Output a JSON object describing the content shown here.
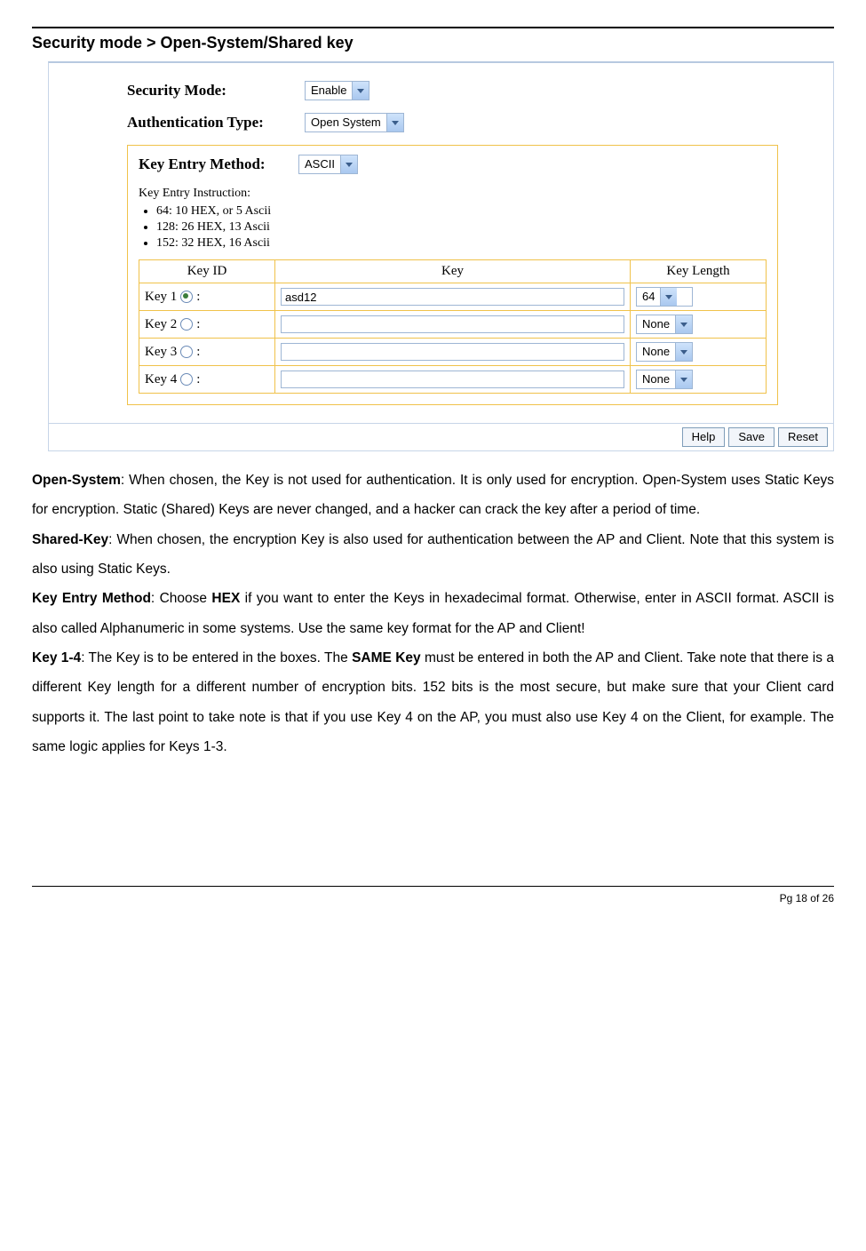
{
  "heading": "Security mode > Open-System/Shared key",
  "form": {
    "security_mode_label": "Security Mode:",
    "security_mode_value": "Enable",
    "auth_type_label": "Authentication Type:",
    "auth_type_value": "Open System",
    "key_entry_label": "Key Entry Method:",
    "key_entry_value": "ASCII",
    "instr_title": "Key Entry Instruction:",
    "instr": [
      "64: 10 HEX, or 5 Ascii",
      "128: 26 HEX, 13 Ascii",
      "152: 32 HEX, 16 Ascii"
    ],
    "table": {
      "headers": {
        "id": "Key ID",
        "key": "Key",
        "len": "Key Length"
      },
      "rows": [
        {
          "id": "Key 1",
          "checked": true,
          "value": "asd12",
          "len": "64"
        },
        {
          "id": "Key 2",
          "checked": false,
          "value": "",
          "len": "None"
        },
        {
          "id": "Key 3",
          "checked": false,
          "value": "",
          "len": "None"
        },
        {
          "id": "Key 4",
          "checked": false,
          "value": "",
          "len": "None"
        }
      ]
    },
    "buttons": {
      "help": "Help",
      "save": "Save",
      "reset": "Reset"
    }
  },
  "paragraphs": {
    "p1a": "Open-System",
    "p1b": ": When chosen, the Key is not used for authentication. It is only used for encryption. Open-System uses Static Keys for encryption. Static (Shared) Keys are never changed, and a hacker can crack the key after a period of time.",
    "p2a": "Shared-Key",
    "p2b": ": When chosen, the encryption Key is also used for authentication between the AP and Client. Note that this system is also using Static Keys.",
    "p3a": "Key Entry Method",
    "p3b": ": Choose ",
    "p3c": "HEX",
    "p3d": " if you want to enter the Keys in hexadecimal format. Otherwise, enter in ASCII format. ASCII is also called Alphanumeric in some systems. Use the same key format for the AP and Client!",
    "p4a": "Key 1-4",
    "p4b": ": The Key is to be entered in the boxes. The ",
    "p4c": "SAME Key",
    "p4d": " must be entered in both the AP and Client. Take note that there is a different Key length for a different number of encryption bits. 152 bits is the most secure, but make sure that your Client card supports it. The last point to take note is that if you use Key 4 on the AP, you must also use Key 4 on the Client, for example. The same logic applies for Keys 1-3."
  },
  "footer": "Pg 18 of 26"
}
